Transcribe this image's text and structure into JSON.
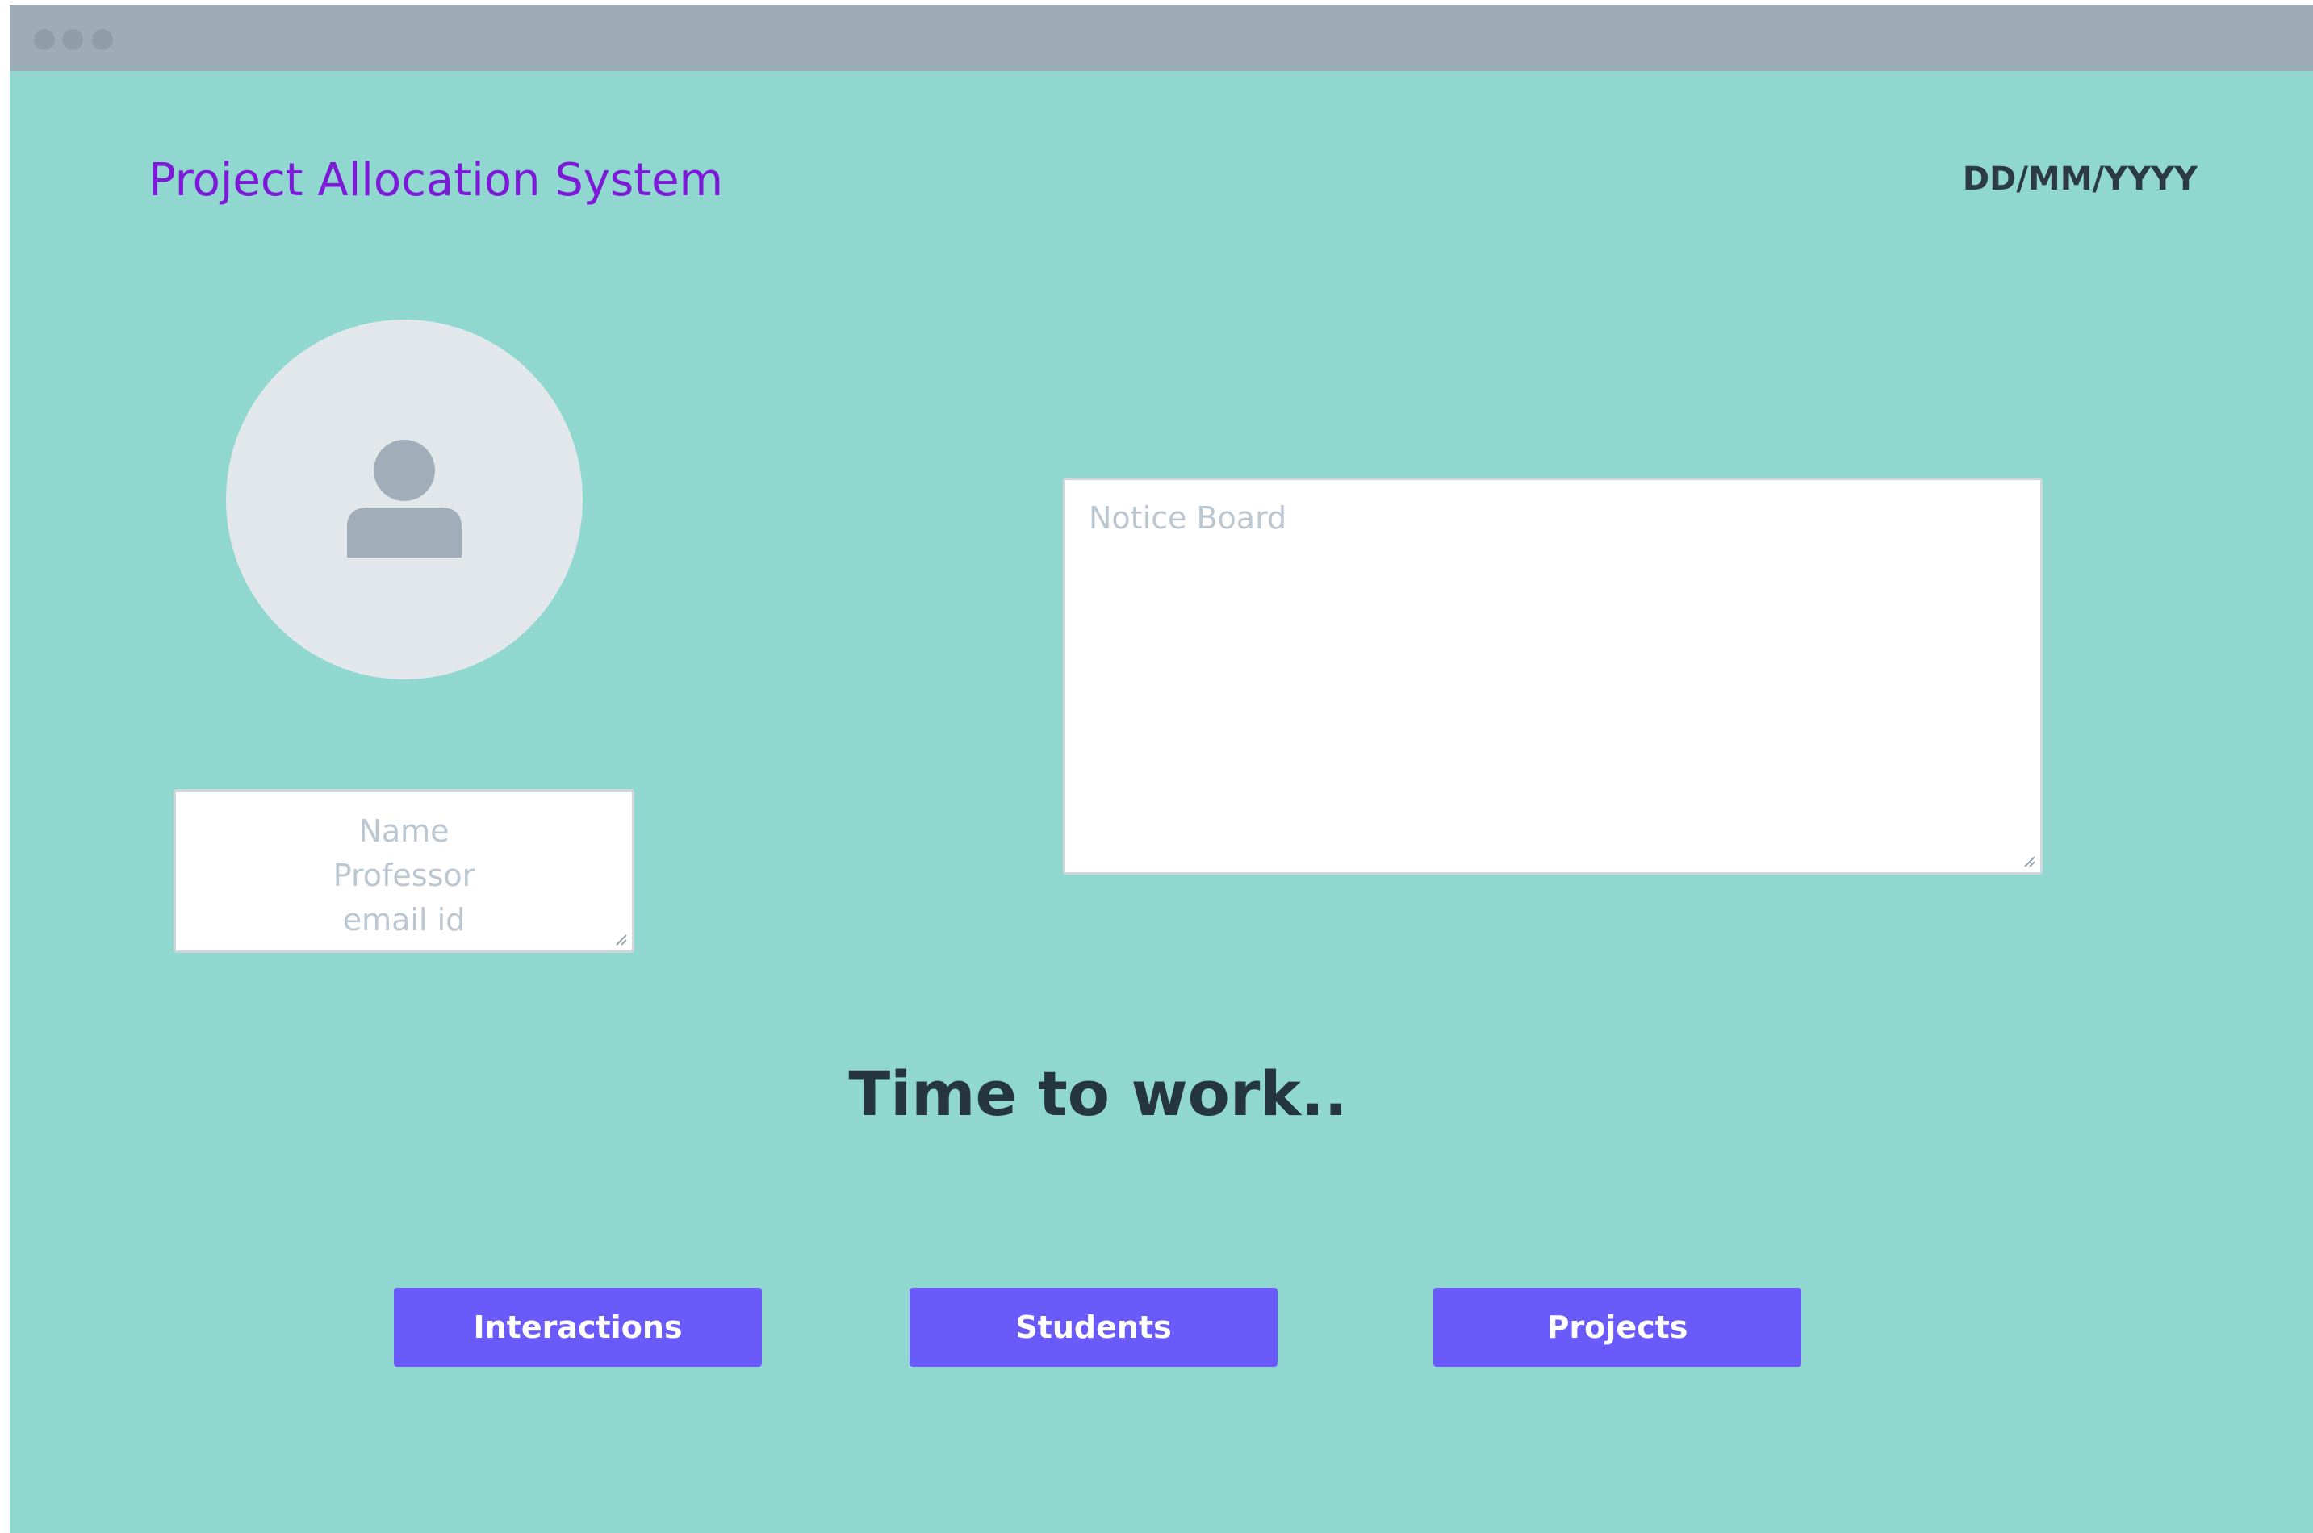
{
  "window": {
    "controls": [
      "window-dot",
      "window-dot",
      "window-dot"
    ]
  },
  "header": {
    "app_title": "Project Allocation System",
    "date": "DD/MM/YYYY"
  },
  "profile": {
    "avatar_icon": "user-icon",
    "lines": [
      "Name",
      "Professor",
      "email id"
    ]
  },
  "notice_board": {
    "title": "Notice Board"
  },
  "main": {
    "tagline": "Time to work.."
  },
  "buttons": {
    "interactions": "Interactions",
    "students": "Students",
    "projects": "Projects"
  },
  "colors": {
    "background": "#8fd7cf",
    "titlebar": "#9eacb8",
    "accent_button": "#6a5af9",
    "title_text": "#7d1ad8",
    "placeholder_text": "#bcc7d1",
    "avatar_bg": "#e2e7ec",
    "avatar_icon": "#a1aeba"
  }
}
